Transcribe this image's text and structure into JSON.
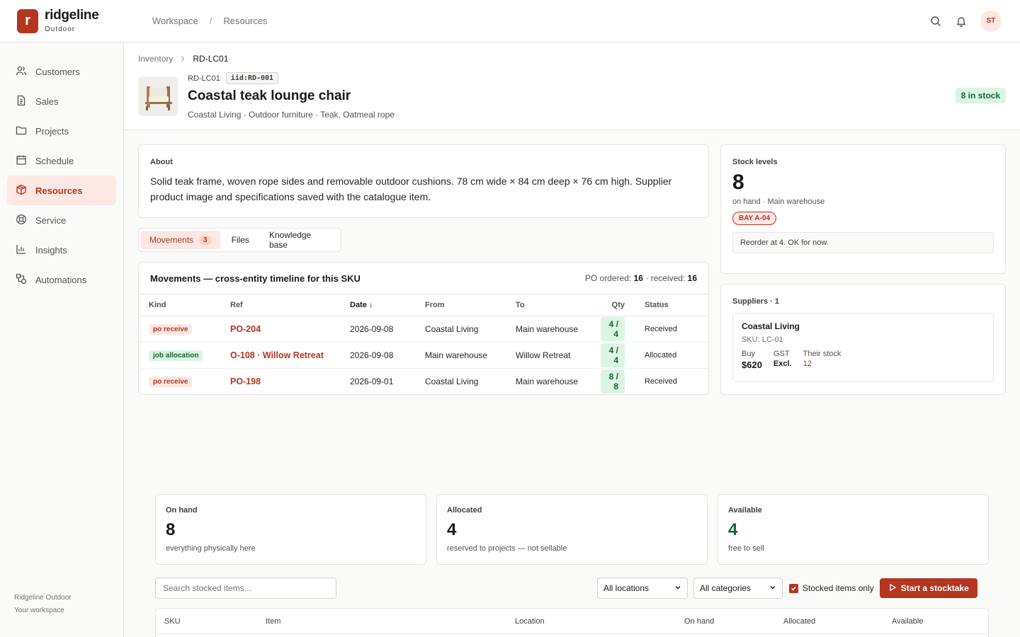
{
  "brand": {
    "name": "ridgeline",
    "sub": "Outdoor",
    "logo_letter": "r"
  },
  "top_crumbs": [
    "Workspace",
    "Resources"
  ],
  "top_sep": "/",
  "user_initials": "ST",
  "sidebar": {
    "items": [
      {
        "label": "Customers",
        "icon": "users-icon"
      },
      {
        "label": "Sales",
        "icon": "document-icon"
      },
      {
        "label": "Projects",
        "icon": "folder-icon"
      },
      {
        "label": "Schedule",
        "icon": "calendar-icon"
      },
      {
        "label": "Resources",
        "icon": "box-icon",
        "active": true
      },
      {
        "label": "Service",
        "icon": "lifebuoy-icon"
      },
      {
        "label": "Insights",
        "icon": "bar-chart-icon"
      },
      {
        "label": "Automations",
        "icon": "shapes-icon"
      }
    ],
    "footer_line1": "Ridgeline Outdoor",
    "footer_line2": "Your workspace"
  },
  "crumbs": {
    "parent": "Inventory",
    "current": "RD-LC01"
  },
  "item": {
    "sku": "RD-LC01",
    "iid": "iid:RD-001",
    "title": "Coastal teak lounge chair",
    "subtitle": "Coastal Living · Outdoor furniture · Teak, Oatmeal rope",
    "stock_badge": "8 in stock"
  },
  "about": {
    "label": "About",
    "text": "Solid teak frame, woven rope sides and removable outdoor cushions. 78 cm wide × 84 cm deep × 76 cm high. Supplier product image and specifications saved with the catalogue item."
  },
  "tabs": [
    {
      "label": "Movements",
      "count": "3",
      "active": true
    },
    {
      "label": "Files"
    },
    {
      "label": "Knowledge base"
    }
  ],
  "movements": {
    "title": "Movements — cross-entity timeline for this SKU",
    "meta_ordered_label": "PO ordered:",
    "meta_ordered": "16",
    "meta_received_label": "· received:",
    "meta_received": "16",
    "columns": [
      "Kind",
      "Ref",
      "Date ↓",
      "From",
      "To",
      "Qty",
      "Status"
    ],
    "rows": [
      {
        "kind": "po receive",
        "kind_type": "po",
        "ref": "PO-204",
        "date": "2026-09-08",
        "from": "Coastal Living",
        "to": "Main warehouse",
        "qty": "4 / 4",
        "status": "Received"
      },
      {
        "kind": "job allocation",
        "kind_type": "job",
        "ref": "O-108 · Willow Retreat",
        "date": "2026-09-08",
        "from": "Main warehouse",
        "to": "Willow Retreat",
        "qty": "4 / 4",
        "status": "Allocated"
      },
      {
        "kind": "po receive",
        "kind_type": "po",
        "ref": "PO-198",
        "date": "2026-09-01",
        "from": "Coastal Living",
        "to": "Main warehouse",
        "qty": "8 / 8",
        "status": "Received"
      }
    ]
  },
  "stock_levels": {
    "label": "Stock levels",
    "value": "8",
    "sub": "on hand · Main warehouse",
    "bay": "BAY A-04",
    "reorder": "Reorder at 4. OK for now."
  },
  "suppliers": {
    "label": "Suppliers · 1",
    "name": "Coastal Living",
    "sku": "SKU: LC-01",
    "buy_label": "Buy",
    "buy": "$620",
    "gst_label": "GST",
    "gst": "Excl.",
    "their_label": "Their stock",
    "their": "12"
  },
  "kpis": [
    {
      "label": "On hand",
      "value": "8",
      "desc": "everything physically here"
    },
    {
      "label": "Allocated",
      "value": "4",
      "desc": "reserved to projects — not sellable"
    },
    {
      "label": "Available",
      "value": "4",
      "desc": "free to sell",
      "green": true
    }
  ],
  "toolbar": {
    "search_placeholder": "Search stocked items...",
    "location": "All locations",
    "category": "All categories",
    "stocked_only": "Stocked items only",
    "start": "Start a stocktake"
  },
  "stock_table": {
    "columns": [
      "SKU",
      "Item",
      "Location",
      "On hand",
      "Allocated",
      "Available"
    ]
  },
  "colors": {
    "accent": "#b5361f",
    "accent_soft": "#fde8e4",
    "success": "#166534",
    "success_soft": "#dcf5e3"
  }
}
